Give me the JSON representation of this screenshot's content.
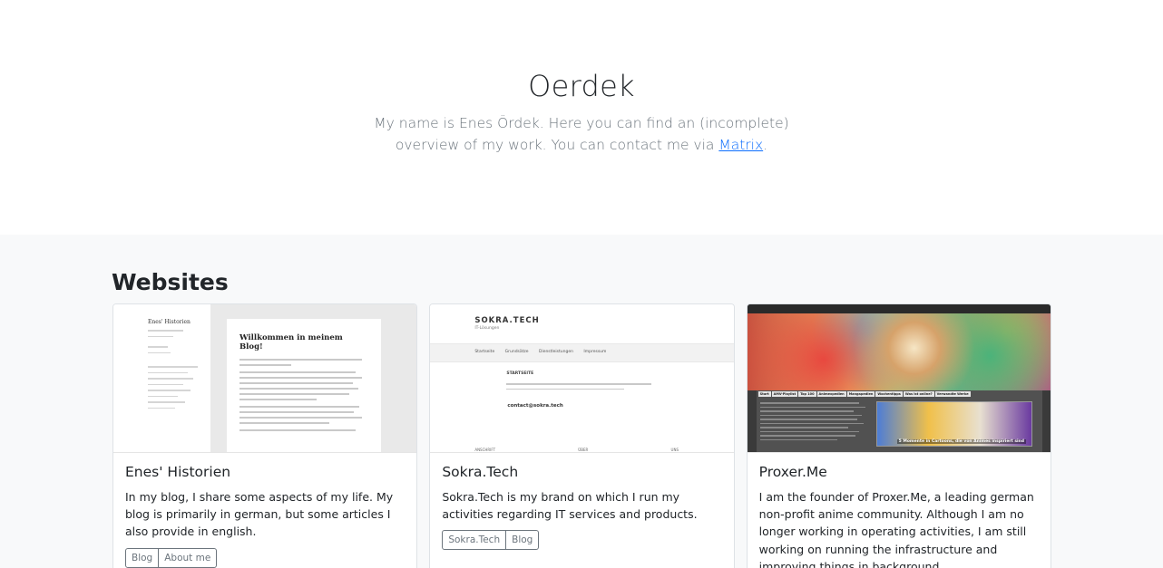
{
  "hero": {
    "title": "Oerdek",
    "intro": "My name is Enes Ördek. Here you can find an (incomplete) overview of my work. You can contact me via ",
    "contact_link": "Matrix",
    "trailing": "."
  },
  "section": {
    "title": "Websites"
  },
  "cards": [
    {
      "title": "Enes' Historien",
      "text": "In my blog, I share some aspects of my life. My blog is primarily in german, but some articles I also provide in english.",
      "buttons": [
        "Blog",
        "About me"
      ],
      "thumb": {
        "site_title": "Enes' Historien",
        "heading": "Willkommen in meinem Blog!"
      }
    },
    {
      "title": "Sokra.Tech",
      "text": "Sokra.Tech is my brand on which I run my activities regarding IT services and products.",
      "buttons": [
        "Sokra.Tech",
        "Blog"
      ],
      "thumb": {
        "brand": "SOKRA.TECH",
        "sub": "IT-Lösungen",
        "nav": "Startseite Grundsätze Dienstleistungen Impressum",
        "content": "STARTSEITE",
        "mail": "contact@sokra.tech",
        "foot": "ANSCHRIFT ÜBER UNS"
      }
    },
    {
      "title": "Proxer.Me",
      "text": "I am the founder of Proxer.Me, a leading german non-profit anime community. Although I am no longer working in operating activities, I am still working on running the infrastructure and improving things in background.",
      "buttons": [],
      "thumb": {
        "tabs": [
          "Start",
          "AMV-Playlist",
          "Top 100",
          "Animexpedien",
          "Mangapedien",
          "Wochentipps",
          "Was ist online?",
          "Verwandte Werke"
        ],
        "feature_caption": "5 Momente in Cartoons, die von Animes inspiriert sind"
      }
    }
  ]
}
